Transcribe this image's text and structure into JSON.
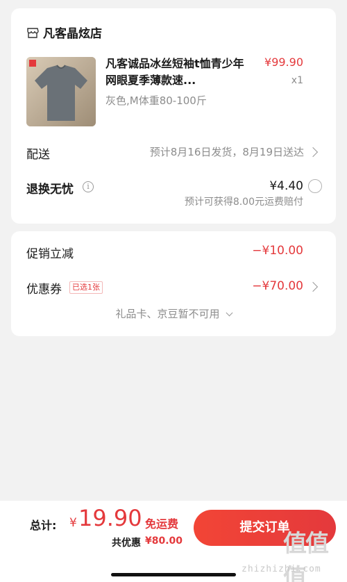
{
  "order": {
    "store_name": "凡客晶炫店",
    "product": {
      "title": "凡客诚品冰丝短袖t恤青少年网眼夏季薄款速...",
      "price": "¥99.90",
      "qty": "x1",
      "spec": "灰色,M体重80-100斤"
    },
    "delivery": {
      "label": "配送",
      "info": "预计8月16日发货，8月19日送达"
    },
    "return": {
      "label": "退换无忧",
      "price": "¥4.40",
      "note": "预计可获得8.00元运费赔付"
    }
  },
  "discounts": {
    "promo_label": "促销立减",
    "promo_value": "−¥10.00",
    "coupon_label": "优惠券",
    "coupon_badge": "已选1张",
    "coupon_value": "−¥70.00",
    "gift_note": "礼品卡、京豆暂不可用"
  },
  "footer": {
    "total_label": "总计:",
    "currency": "¥",
    "total_amount": "19.90",
    "free_shipping": "免运费",
    "saving_label": "共优惠",
    "saving_amount": "¥80.00",
    "submit_label": "提交订单"
  },
  "watermark": {
    "logo": "值值值",
    "url": "zhizhizhi.com"
  },
  "colors": {
    "accent": "#e4393c",
    "background": "#f2f2f2"
  },
  "icons": [
    "store-icon",
    "tshirt-thumbnail",
    "chevron-right-icon",
    "info-icon",
    "radio-icon",
    "chevron-down-icon"
  ]
}
